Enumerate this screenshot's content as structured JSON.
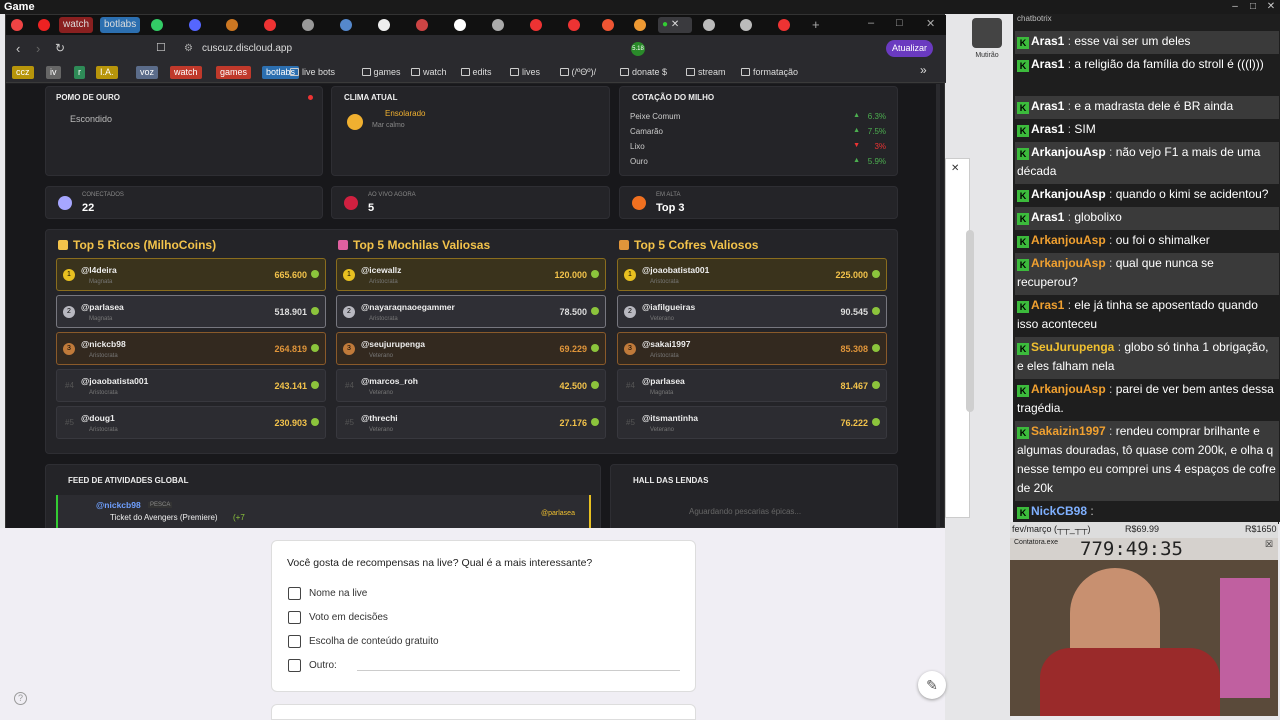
{
  "window": {
    "title": "Game"
  },
  "tabs": [
    {
      "label": "watch",
      "color": "#c0392b"
    },
    {
      "label": "botlabs",
      "color": "#2c6fb0"
    }
  ],
  "address": {
    "url": "cuscuz.discloud.app",
    "update_label": "Atualizar",
    "ext_badge": "5.18"
  },
  "bookmarks": {
    "tags": [
      {
        "label": "ccz",
        "color": "#b7950b"
      },
      {
        "label": "iv",
        "color": "#666"
      },
      {
        "label": "r",
        "color": "#2e8b57"
      },
      {
        "label": "I.A.",
        "color": "#b7950b"
      },
      {
        "label": "voz",
        "color": "#5b6c8a"
      },
      {
        "label": "watch",
        "color": "#c0392b"
      },
      {
        "label": "games",
        "color": "#c0392b"
      },
      {
        "label": "botlabs",
        "color": "#2c6fb0"
      }
    ],
    "items": [
      "live bots",
      "games",
      "watch",
      "edits",
      "lives",
      "(/ºΘº)/",
      "donate $",
      "stream",
      "formatação"
    ]
  },
  "dashboard": {
    "pomo": {
      "title": "POMO DE OURO",
      "status": "Escondido"
    },
    "clima": {
      "title": "CLIMA ATUAL",
      "weather": "Ensolarado",
      "sea": "Mar calmo"
    },
    "milho": {
      "title": "COTAÇÃO DO MILHO",
      "items": [
        {
          "name": "Peixe Comum",
          "change": "6.3%",
          "dir": "up"
        },
        {
          "name": "Camarão",
          "change": "7.5%",
          "dir": "up"
        },
        {
          "name": "Lixo",
          "change": "3%",
          "dir": "down"
        },
        {
          "name": "Ouro",
          "change": "5.9%",
          "dir": "up"
        }
      ]
    },
    "stats": [
      {
        "label": "CONECTADOS",
        "value": "22"
      },
      {
        "label": "AO VIVO AGORA",
        "value": "5"
      },
      {
        "label": "EM ALTA",
        "value": "Top 3"
      }
    ],
    "rankings": [
      {
        "title": "Top 5 Ricos (MilhoCoins)",
        "rows": [
          {
            "user": "@l4deira",
            "rank": "Magnata",
            "value": "665.600"
          },
          {
            "user": "@parlasea",
            "rank": "Magnata",
            "value": "518.901"
          },
          {
            "user": "@nickcb98",
            "rank": "Aristocrata",
            "value": "264.819"
          },
          {
            "user": "@joaobatista001",
            "rank": "Aristocrata",
            "value": "243.141"
          },
          {
            "user": "@doug1",
            "rank": "Aristocrata",
            "value": "230.903"
          }
        ]
      },
      {
        "title": "Top 5 Mochilas Valiosas",
        "rows": [
          {
            "user": "@icewallz",
            "rank": "Aristocrata",
            "value": "120.000"
          },
          {
            "user": "@nayaraqnaoegammer",
            "rank": "Aristocrata",
            "value": "78.500"
          },
          {
            "user": "@seujurupenga",
            "rank": "Veterano",
            "value": "69.229"
          },
          {
            "user": "@marcos_roh",
            "rank": "Veterano",
            "value": "42.500"
          },
          {
            "user": "@threchi",
            "rank": "Veterano",
            "value": "27.176"
          }
        ]
      },
      {
        "title": "Top 5 Cofres Valiosos",
        "rows": [
          {
            "user": "@joaobatista001",
            "rank": "Aristocrata",
            "value": "225.000"
          },
          {
            "user": "@iafilgueiras",
            "rank": "Veterano",
            "value": "90.545"
          },
          {
            "user": "@sakai1997",
            "rank": "Aristocrata",
            "value": "85.308"
          },
          {
            "user": "@parlasea",
            "rank": "Magnata",
            "value": "81.467"
          },
          {
            "user": "@itsmantinha",
            "rank": "Veterano",
            "value": "76.222"
          }
        ]
      }
    ],
    "feed": {
      "title": "FEED DE ATIVIDADES GLOBAL",
      "user": "@nickcb98",
      "tag": "PESCA",
      "item": "Ticket do Avengers (Premiere)",
      "bonus": "(+7",
      "target": "@parlasea"
    },
    "hall": {
      "title": "HALL DAS LENDAS",
      "empty": "Aguardando pescarias épicas..."
    }
  },
  "form": {
    "question": "Você gosta de recompensas na live? Qual é a mais interessante?",
    "options": [
      "Nome na live",
      "Voto em decisões",
      "Escolha de conteúdo gratuito",
      "Outro:"
    ]
  },
  "desktop": {
    "icon_label": "Mutirão"
  },
  "chat": {
    "header": "chatbotrix",
    "messages": [
      {
        "nick": "Aras1",
        "color": "#ffffff",
        "text": "esse vai ser um deles"
      },
      {
        "nick": "Aras1",
        "color": "#ffffff",
        "text": "a religião da família do stroll é (((l)))"
      },
      {
        "nick": "Aras1",
        "color": "#ffffff",
        "text": "e a madrasta dele é BR ainda"
      },
      {
        "nick": "Aras1",
        "color": "#ffffff",
        "text": "SIM"
      },
      {
        "nick": "ArkanjouAsp",
        "color": "#ffffff",
        "text": "não vejo F1 a mais de uma década"
      },
      {
        "nick": "ArkanjouAsp",
        "color": "#ffffff",
        "text": "quando o kimi se acidentou?"
      },
      {
        "nick": "Aras1",
        "color": "#ffffff",
        "text": "globolixo"
      },
      {
        "nick": "ArkanjouAsp",
        "color": "#f0a030",
        "text": "ou foi o shimalker"
      },
      {
        "nick": "ArkanjouAsp",
        "color": "#f0a030",
        "text": "qual que nunca se recuperou?"
      },
      {
        "nick": "Aras1",
        "color": "#f0a030",
        "text": "ele já tinha se aposentado quando isso aconteceu"
      },
      {
        "nick": "SeuJurupenga",
        "color": "#f0c030",
        "text": "globo só tinha 1 obrigação, e eles falham nela"
      },
      {
        "nick": "ArkanjouAsp",
        "color": "#f0a030",
        "text": "parei de ver bem antes dessa tragédia."
      },
      {
        "nick": "Sakaizin1997",
        "color": "#f0a030",
        "text": "rendeu comprar brilhante e algumas douradas, tô quase com 200k, e olha q nesse tempo eu comprei uns 4 espaços de cofre de 20k"
      },
      {
        "nick": "NickCB98",
        "color": "#7fb0ff",
        "text": ""
      }
    ]
  },
  "overlay": {
    "goal_label": "fev/março (┬┬_┬┬)",
    "goal_current": "R$69.99",
    "goal_target": "R$1650",
    "timer": "779:49:35",
    "timer_label": "Contatora.exe"
  }
}
